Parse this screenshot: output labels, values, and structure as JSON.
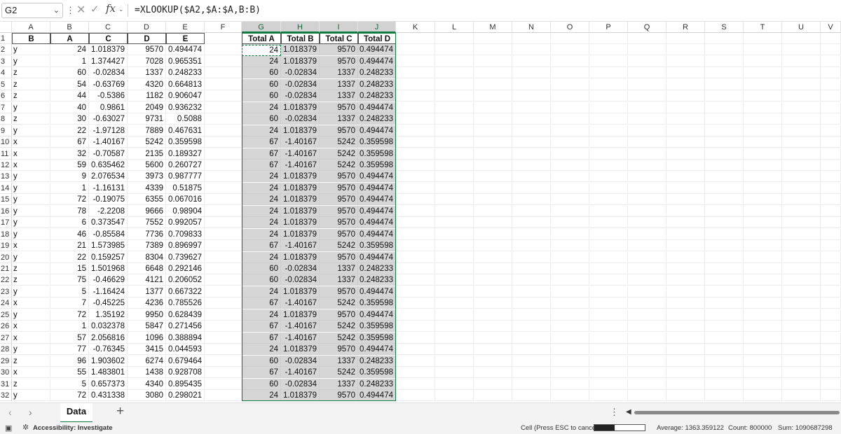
{
  "formula_bar": {
    "name_box": "G2",
    "more_symbol": "⋮",
    "cancel_symbol": "✕",
    "enter_symbol": "✓",
    "fx_label": "fx",
    "formula": "=XLOOKUP($A2,$A:$A,B:B)"
  },
  "columns": [
    "A",
    "B",
    "C",
    "D",
    "E",
    "F",
    "G",
    "H",
    "I",
    "J",
    "K",
    "L",
    "M",
    "N",
    "O",
    "P",
    "Q",
    "R",
    "S",
    "T",
    "U",
    "V"
  ],
  "selected_columns": [
    "G",
    "H",
    "I",
    "J"
  ],
  "row_numbers": [
    "1",
    "2",
    "3",
    "4",
    "5",
    "6",
    "7",
    "8",
    "9",
    "10",
    "11",
    "12",
    "13",
    "14",
    "15",
    "16",
    "17",
    "18",
    "19",
    "20",
    "21",
    "22",
    "23",
    "24",
    "25",
    "26",
    "27",
    "28",
    "29",
    "30",
    "31",
    "32"
  ],
  "header_row": [
    "B",
    "A",
    "C",
    "D",
    "E",
    "",
    "Total A",
    "Total B",
    "Total C",
    "Total D"
  ],
  "rows": [
    [
      "y",
      "24",
      "1.018379",
      "9570",
      "0.494474",
      "",
      "24",
      "1.018379",
      "9570",
      "0.494474"
    ],
    [
      "y",
      "1",
      "1.374427",
      "7028",
      "0.965351",
      "",
      "24",
      "1.018379",
      "9570",
      "0.494474"
    ],
    [
      "z",
      "60",
      "-0.02834",
      "1337",
      "0.248233",
      "",
      "60",
      "-0.02834",
      "1337",
      "0.248233"
    ],
    [
      "z",
      "54",
      "-0.63769",
      "4320",
      "0.664813",
      "",
      "60",
      "-0.02834",
      "1337",
      "0.248233"
    ],
    [
      "z",
      "44",
      "-0.5386",
      "1182",
      "0.906047",
      "",
      "60",
      "-0.02834",
      "1337",
      "0.248233"
    ],
    [
      "y",
      "40",
      "0.9861",
      "2049",
      "0.936232",
      "",
      "24",
      "1.018379",
      "9570",
      "0.494474"
    ],
    [
      "z",
      "30",
      "-0.63027",
      "9731",
      "0.5088",
      "",
      "60",
      "-0.02834",
      "1337",
      "0.248233"
    ],
    [
      "y",
      "22",
      "-1.97128",
      "7889",
      "0.467631",
      "",
      "24",
      "1.018379",
      "9570",
      "0.494474"
    ],
    [
      "x",
      "67",
      "-1.40167",
      "5242",
      "0.359598",
      "",
      "67",
      "-1.40167",
      "5242",
      "0.359598"
    ],
    [
      "x",
      "32",
      "-0.70587",
      "2135",
      "0.189327",
      "",
      "67",
      "-1.40167",
      "5242",
      "0.359598"
    ],
    [
      "x",
      "59",
      "0.635462",
      "5600",
      "0.260727",
      "",
      "67",
      "-1.40167",
      "5242",
      "0.359598"
    ],
    [
      "y",
      "9",
      "2.076534",
      "3973",
      "0.987777",
      "",
      "24",
      "1.018379",
      "9570",
      "0.494474"
    ],
    [
      "y",
      "1",
      "-1.16131",
      "4339",
      "0.51875",
      "",
      "24",
      "1.018379",
      "9570",
      "0.494474"
    ],
    [
      "y",
      "72",
      "-0.19075",
      "6355",
      "0.067016",
      "",
      "24",
      "1.018379",
      "9570",
      "0.494474"
    ],
    [
      "y",
      "78",
      "-2.2208",
      "9666",
      "0.98904",
      "",
      "24",
      "1.018379",
      "9570",
      "0.494474"
    ],
    [
      "y",
      "6",
      "0.373547",
      "7552",
      "0.992057",
      "",
      "24",
      "1.018379",
      "9570",
      "0.494474"
    ],
    [
      "y",
      "46",
      "-0.85584",
      "7736",
      "0.709833",
      "",
      "24",
      "1.018379",
      "9570",
      "0.494474"
    ],
    [
      "x",
      "21",
      "1.573985",
      "7389",
      "0.896997",
      "",
      "67",
      "-1.40167",
      "5242",
      "0.359598"
    ],
    [
      "y",
      "22",
      "0.159257",
      "8304",
      "0.739627",
      "",
      "24",
      "1.018379",
      "9570",
      "0.494474"
    ],
    [
      "z",
      "15",
      "1.501968",
      "6648",
      "0.292146",
      "",
      "60",
      "-0.02834",
      "1337",
      "0.248233"
    ],
    [
      "z",
      "75",
      "-0.46629",
      "4121",
      "0.206052",
      "",
      "60",
      "-0.02834",
      "1337",
      "0.248233"
    ],
    [
      "y",
      "5",
      "-1.16424",
      "1377",
      "0.667322",
      "",
      "24",
      "1.018379",
      "9570",
      "0.494474"
    ],
    [
      "x",
      "7",
      "-0.45225",
      "4236",
      "0.785526",
      "",
      "67",
      "-1.40167",
      "5242",
      "0.359598"
    ],
    [
      "y",
      "72",
      "1.35192",
      "9950",
      "0.628439",
      "",
      "24",
      "1.018379",
      "9570",
      "0.494474"
    ],
    [
      "x",
      "1",
      "0.032378",
      "5847",
      "0.271456",
      "",
      "67",
      "-1.40167",
      "5242",
      "0.359598"
    ],
    [
      "x",
      "57",
      "2.056816",
      "1096",
      "0.388894",
      "",
      "67",
      "-1.40167",
      "5242",
      "0.359598"
    ],
    [
      "y",
      "77",
      "-0.76345",
      "3415",
      "0.044593",
      "",
      "24",
      "1.018379",
      "9570",
      "0.494474"
    ],
    [
      "z",
      "96",
      "1.903602",
      "6274",
      "0.679464",
      "",
      "60",
      "-0.02834",
      "1337",
      "0.248233"
    ],
    [
      "x",
      "55",
      "1.483801",
      "1438",
      "0.928708",
      "",
      "67",
      "-1.40167",
      "5242",
      "0.359598"
    ],
    [
      "z",
      "5",
      "0.657373",
      "4340",
      "0.895435",
      "",
      "60",
      "-0.02834",
      "1337",
      "0.248233"
    ],
    [
      "y",
      "72",
      "0.431338",
      "3080",
      "0.298021",
      "",
      "24",
      "1.018379",
      "9570",
      "0.494474"
    ]
  ],
  "sheet_tabs": {
    "prev_symbol": "‹",
    "next_symbol": "›",
    "active": "Data",
    "add_symbol": "+",
    "more_symbol": "⋮"
  },
  "status_bar": {
    "accessibility": "Accessibility: Investigate",
    "mode": "Cell (Press ESC to cancel):",
    "progress": 0.4,
    "average": "Average: 1363.359122",
    "count": "Count: 800000",
    "sum": "Sum: 1090687298"
  },
  "colors": {
    "accent": "#107c41",
    "selection": "#d6d6d6"
  }
}
